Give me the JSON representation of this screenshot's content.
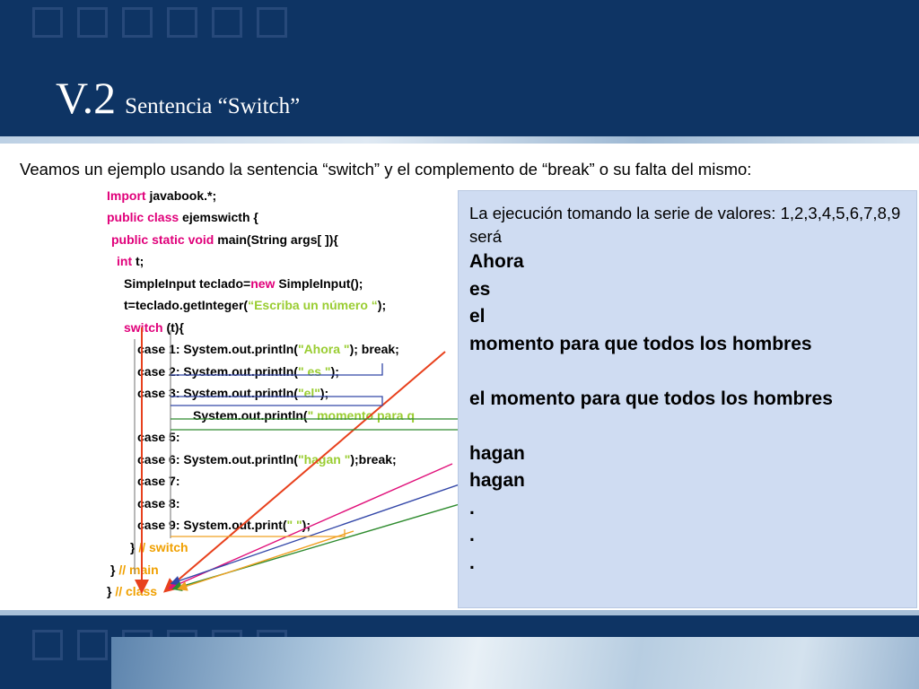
{
  "slide": {
    "title_main": "V.2",
    "title_sub": "Sentencia “Switch”",
    "intro": "Veamos un ejemplo  usando la sentencia “switch” y el complemento de “break” o su falta del mismo:"
  },
  "code": {
    "line1": {
      "kw": "Import",
      "text": " javabook.*;"
    },
    "line2": {
      "kw": "public class",
      "text": " ejemswicth {"
    },
    "line3": {
      "kw": "public static void",
      "text": " main(String args[ ]){"
    },
    "line4": {
      "kw": "int",
      "text": " t;"
    },
    "line5": {
      "pre": "SimpleInput teclado=",
      "kw": "new",
      "post": " SimpleInput();"
    },
    "line6": {
      "pre": "t=teclado.getInteger(",
      "str": "“Escriba un número “",
      "post": ");"
    },
    "line7": {
      "kw": "switch",
      "text": " (t){"
    },
    "line8": {
      "pre": "case 1: System.out.println(",
      "str": "\"Ahora \"",
      "post": "); break;"
    },
    "line9": {
      "pre": "case 2: System.out.println(",
      "str": "\" es \"",
      "post": ");"
    },
    "line10": {
      "pre": "case 3: System.out.println(",
      "str": "\"el\"",
      "post": ");"
    },
    "line11": {
      "pre": "System.out.println(",
      "str": "\" momento para q"
    },
    "line12": {
      "text": "case 5:"
    },
    "line13": {
      "pre": "case 6: System.out.println(",
      "str": "\"hagan \"",
      "post": ");break;"
    },
    "line14": {
      "text": "case 7:"
    },
    "line15": {
      "text": "case 8:"
    },
    "line16": {
      "pre": "case 9: System.out.print(",
      "str": "\" \"",
      "post": ");"
    },
    "line17": {
      "pre": "} ",
      "cmt": "// switch"
    },
    "line18": {
      "pre": "}  ",
      "cmt": "// main"
    },
    "line19": {
      "pre": "}  ",
      "cmt": "// class"
    }
  },
  "panel": {
    "heading": "La ejecución  tomando la serie de valores: 1,2,3,4,5,6,7,8,9 será",
    "output": [
      "Ahora",
      "es",
      "el",
      "momento para que todos los hombres",
      "",
      "el momento para que todos los hombres",
      "",
      "hagan",
      "hagan",
      ".",
      ".",
      "."
    ]
  },
  "colors": {
    "header_bg": "#0e3464",
    "keyword": "#e0007a",
    "string": "#9acd32",
    "comment": "#f0a000",
    "panel_bg": "#cfdcf2",
    "arrow_red": "#e8401c",
    "arrow_blue": "#3347a8",
    "arrow_green": "#2e8b2e",
    "arrow_magenta": "#e0107a",
    "arrow_orange": "#f0a020"
  }
}
